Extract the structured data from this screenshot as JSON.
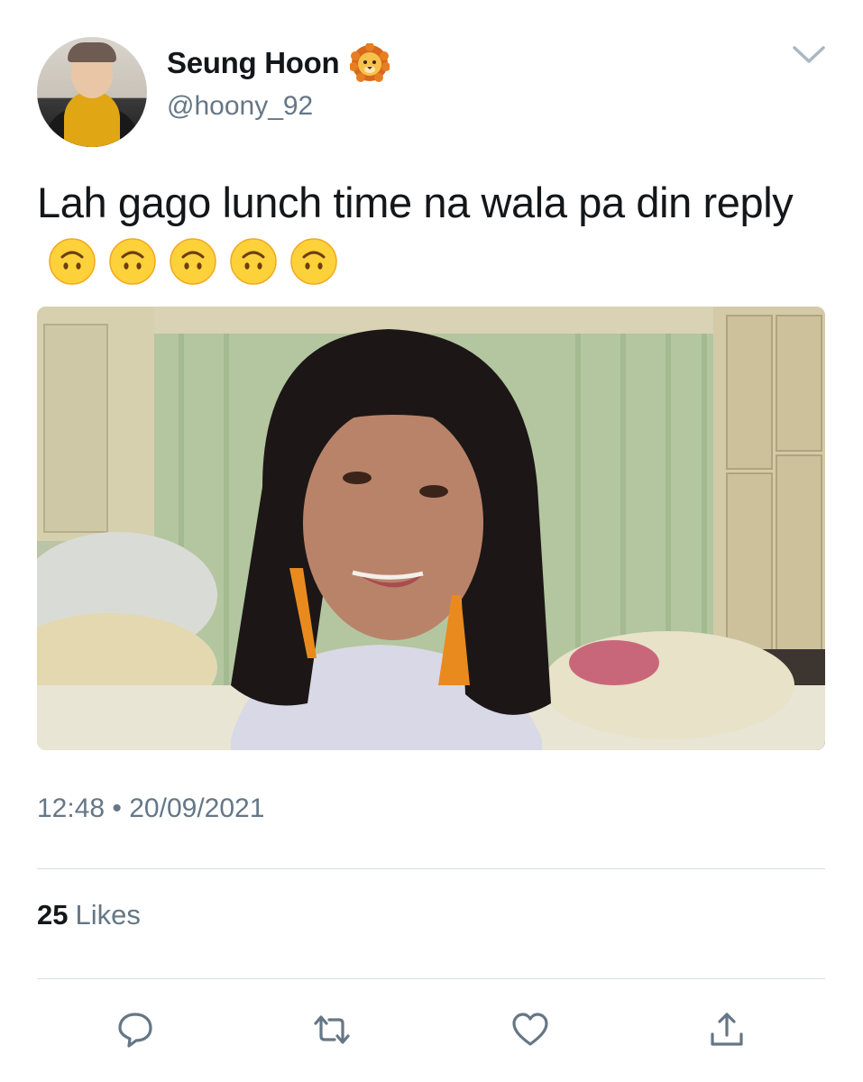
{
  "tweet": {
    "author": {
      "display_name": "Seung Hoon",
      "name_emoji": "lion-face-icon",
      "handle": "@hoony_92"
    },
    "text": "Lah gago lunch time na wala pa din reply",
    "text_emojis": [
      "upside-down-face-icon",
      "upside-down-face-icon",
      "upside-down-face-icon",
      "upside-down-face-icon",
      "upside-down-face-icon"
    ],
    "media": {
      "type": "photo"
    },
    "timestamp": "12:48 • 20/09/2021",
    "likes": {
      "count": "25",
      "label": "Likes"
    },
    "actions": [
      "reply-icon",
      "retweet-icon",
      "like-icon",
      "share-icon"
    ]
  },
  "colors": {
    "text_primary": "#14171a",
    "text_secondary": "#657786",
    "divider": "#d8dee3"
  }
}
